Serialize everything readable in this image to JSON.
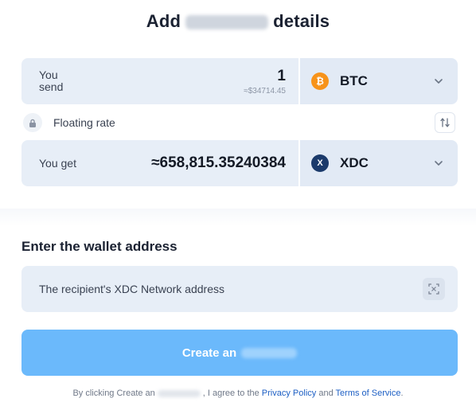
{
  "header": {
    "title_prefix": "Add",
    "title_suffix": "details"
  },
  "send": {
    "label": "You send",
    "amount": "1",
    "usd_estimate": "≈$34714.45",
    "currency": {
      "ticker": "BTC",
      "icon": "bitcoin-icon",
      "color": "#f7931a",
      "glyph": "₿"
    }
  },
  "rate": {
    "label": "Floating rate",
    "icon": "lock-icon",
    "swap_icon": "swap-arrows-icon"
  },
  "get": {
    "label": "You get",
    "amount": "≈658,815.35240384",
    "currency": {
      "ticker": "XDC",
      "icon": "xdc-icon",
      "color": "#1b3a6b",
      "glyph": "X"
    }
  },
  "wallet": {
    "section_title": "Enter the wallet address",
    "placeholder": "The recipient's XDC Network address",
    "scan_icon": "qr-scan-icon"
  },
  "submit": {
    "label": "Create an",
    "color": "#6bb9fb"
  },
  "terms": {
    "prefix": "By clicking Create an",
    "middle": ", I agree to the",
    "privacy_link": "Privacy Policy",
    "and": "and",
    "terms_link": "Terms of Service",
    "suffix": "."
  }
}
